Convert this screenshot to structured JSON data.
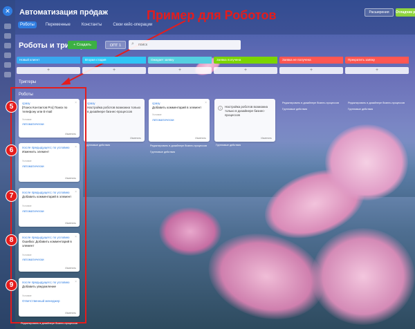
{
  "header": {
    "title": "Автоматизация продаж",
    "tabs": [
      "Роботы",
      "Переменные",
      "Константы",
      "Свои кейс-операции"
    ],
    "ext_button": "Расширения",
    "save_button": "Отладчик роботов"
  },
  "annotation": "Пример для Роботов",
  "toolbar": {
    "title": "Роботы и триггеры",
    "create": "+ Создать",
    "pipeline": "ОПТ 1",
    "search_placeholder": "поиск"
  },
  "stages": [
    {
      "name": "Новый клиент",
      "color": "#39a8ef"
    },
    {
      "name": "Вторая стадия",
      "color": "#2fc6f6"
    },
    {
      "name": "Ожидает заявку",
      "color": "#55d0e0"
    },
    {
      "name": "Заявка получена",
      "color": "#7bd500"
    },
    {
      "name": "Заявка не получена",
      "color": "#ff5752"
    },
    {
      "name": "Прекратить заявку",
      "color": "#ff5752"
    }
  ],
  "labels": {
    "triggers": "Триггеры",
    "robots": "Роботы"
  },
  "cards": [
    {
      "trigger": "сразу",
      "name": "[Поиск Контактов Pro] Поиск по телефону или E-mail",
      "cond": "Условие",
      "exec": "Автоматически",
      "edit": "Изменить",
      "footer": "Групповые действия"
    },
    {
      "trigger": "после предыдущего; по условию",
      "name": "Изменить элемент",
      "cond": "Условие",
      "exec": "Автоматически",
      "edit": "Изменить",
      "footer": ""
    },
    {
      "trigger": "после предыдущего; по условию",
      "name": "Добавить комментарий в элемент",
      "cond": "Условие",
      "exec": "Автоматически",
      "edit": "Изменить",
      "footer": ""
    },
    {
      "trigger": "после предыдущего; по условию",
      "name": "Ошибка: Добавить комментарий в элемент",
      "cond": "Условие",
      "exec": "Автоматически",
      "edit": "Изменить",
      "footer": ""
    },
    {
      "trigger": "после предыдущего; по условию",
      "name": "Добавить уведомление",
      "cond": "Условие",
      "exec": "Ответственный менеджер",
      "edit": "Изменить",
      "footer": ""
    },
    {
      "trigger": "сразу",
      "name": "Настройка роботов возможна только в дизайнере бизнес-процессов",
      "cond": "",
      "exec": "",
      "edit": "Изменить",
      "footer": "Групповые действия"
    },
    {
      "trigger": "сразу",
      "name": "Добавить комментарий в элемент",
      "cond": "Условие",
      "exec": "Автоматически",
      "edit": "Изменить",
      "footer": ""
    },
    {
      "trigger": "",
      "name": "Настройка роботов возможна только в дизайнере бизнес-процессов",
      "cond": "",
      "exec": "",
      "edit": "Изменить",
      "footer": ""
    }
  ],
  "under_text": {
    "designer": "Редактировать в дизайнере бизнес-процессов",
    "group": "Групповые действия"
  },
  "numbers": [
    "5",
    "6",
    "7",
    "8",
    "9"
  ],
  "bottom_note": "Редактировать в дизайнере бизнес-процессов"
}
